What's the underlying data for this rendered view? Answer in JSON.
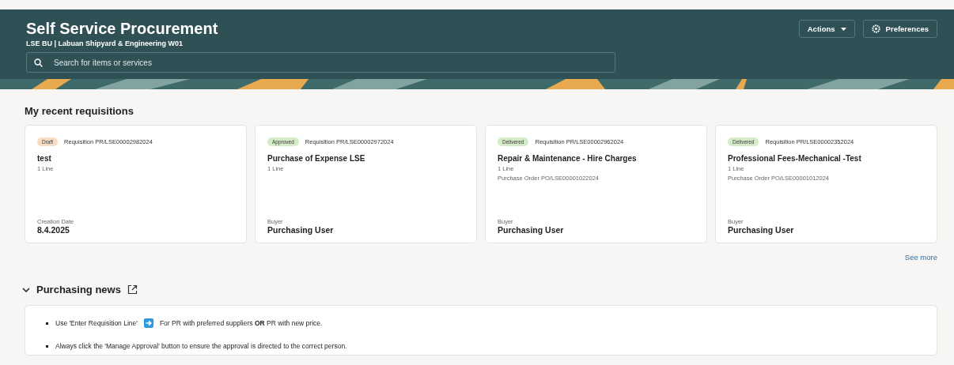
{
  "header": {
    "title": "Self Service Procurement",
    "subtitle": "LSE BU | Labuan Shipyard & Engineering W01",
    "search": {
      "placeholder": "Search for items or services"
    },
    "buttons": [
      {
        "label": "Actions",
        "kind": "menu"
      },
      {
        "label": "Preferences",
        "kind": "settings"
      }
    ]
  },
  "recent": {
    "title": "My recent requisitions",
    "cards": [
      {
        "status": "Draft",
        "color": "#f8dcc4",
        "requisition": "Requisition PR/LSE00002982024",
        "name": "test",
        "lines": "1 Line",
        "detail_label": "Creation Date",
        "detail_value": "8.4.2025"
      },
      {
        "status": "Approved",
        "color": "#d4ebc8",
        "requisition": "Requisition PR/LSE00002972024",
        "name": "Purchase of Expense LSE",
        "lines": "1 Line",
        "detail_label": "Buyer",
        "detail_value": "Purchasing User"
      },
      {
        "status": "Delivered",
        "color": "#d4ebc8",
        "requisition": "Requisition PR/LSE00002962024",
        "name": "Repair & Maintenance - Hire Charges",
        "lines": "1 Line",
        "order": "Purchase Order PO/LSE00001022024",
        "detail_label": "Buyer",
        "detail_value": "Purchasing User"
      },
      {
        "status": "Delivered",
        "color": "#d4ebc8",
        "requisition": "Requisition PR/LSE00002352024",
        "name": "Professional Fees-Mechanical -Test",
        "lines": "1 Line",
        "order": "Purchase Order PO/LSE00001012024",
        "detail_label": "Buyer",
        "detail_value": "Purchasing User"
      }
    ],
    "see_more": "See more"
  },
  "news": {
    "title": "Purchasing news",
    "expanded": true,
    "items": [
      {
        "kind": "arrow",
        "before": "Use 'Enter Requisition Line'",
        "after": "For PR with preferred suppliers **OR** PR with new price."
      },
      {
        "kind": "plain",
        "text": "Always click the 'Manage Approval' button to ensure the approval is directed to the correct person."
      }
    ]
  }
}
